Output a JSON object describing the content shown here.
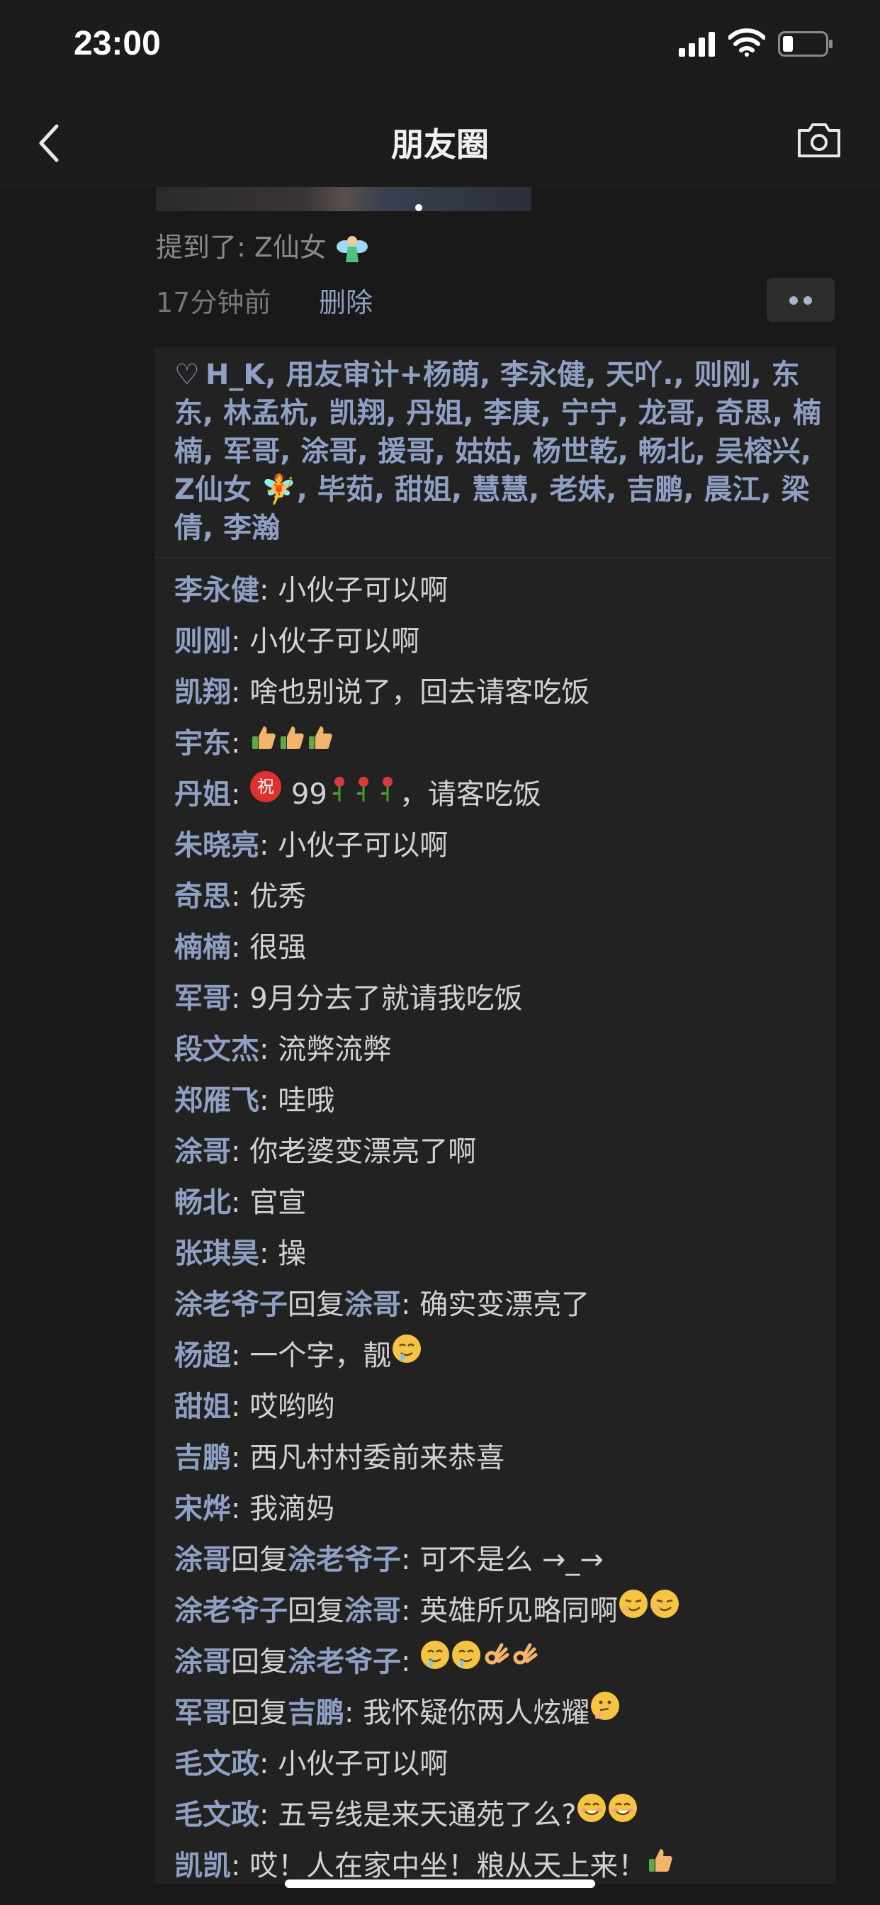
{
  "status_bar": {
    "time": "23:00"
  },
  "nav": {
    "title": "朋友圈"
  },
  "post": {
    "mention_text": "提到了: Z仙女",
    "time_ago": "17分钟前",
    "delete_label": "删除"
  },
  "likes": {
    "names": "H_K, 用友审计+杨萌, 李永健, 天吖., 则刚, 东东, 林孟杭, 凯翔, 丹姐, 李庚, 宁宁, 龙哥, 奇思, 楠楠, 军哥, 涂哥, 援哥, 姑姑, 杨世乾, 畅北, 吴榕兴, Z仙女 🧚, 毕茹, 甜姐, 慧慧, 老妹, 吉鹏, 晨江, 梁倩, 李瀚"
  },
  "comments": [
    {
      "name": "李永健",
      "text": "小伙子可以啊"
    },
    {
      "name": "则刚",
      "text": "小伙子可以啊"
    },
    {
      "name": "凯翔",
      "text": "啥也别说了，回去请客吃饭"
    },
    {
      "name": "宇东",
      "text": "",
      "emojis": [
        "thumb",
        "thumb",
        "thumb"
      ]
    },
    {
      "name": "丹姐",
      "text": "99",
      "pre": [
        "zhu"
      ],
      "emojis": [
        "rose",
        "rose",
        "rose"
      ],
      "text_after": "，请客吃饭"
    },
    {
      "name": "朱晓亮",
      "text": "小伙子可以啊"
    },
    {
      "name": "奇思",
      "text": "优秀"
    },
    {
      "name": "楠楠",
      "text": "很强"
    },
    {
      "name": "军哥",
      "text": "9月分去了就请我吃饭"
    },
    {
      "name": "段文杰",
      "text": "流弊流弊"
    },
    {
      "name": "郑雁飞",
      "text": "哇哦"
    },
    {
      "name": "涂哥",
      "text": "你老婆变漂亮了啊"
    },
    {
      "name": "畅北",
      "text": "官宣"
    },
    {
      "name": "张琪昊",
      "text": "操"
    },
    {
      "name": "涂老爷子",
      "reply_word": "回复",
      "reply_to": "涂哥",
      "text": "确实变漂亮了"
    },
    {
      "name": "杨超",
      "text": "一个字，靓",
      "emojis": [
        "drool"
      ]
    },
    {
      "name": "甜姐",
      "text": "哎哟哟"
    },
    {
      "name": "吉鹏",
      "text": "西凡村村委前来恭喜"
    },
    {
      "name": "宋烨",
      "text": "我滴妈"
    },
    {
      "name": "涂哥",
      "reply_word": "回复",
      "reply_to": "涂老爷子",
      "text": "可不是么 →_→"
    },
    {
      "name": "涂老爷子",
      "reply_word": "回复",
      "reply_to": "涂哥",
      "text": "英雄所见略同啊",
      "emojis": [
        "wink",
        "wink"
      ]
    },
    {
      "name": "涂哥",
      "reply_word": "回复",
      "reply_to": "涂老爷子",
      "text": "",
      "emojis": [
        "drool",
        "drool",
        "ok",
        "ok"
      ]
    },
    {
      "name": "军哥",
      "reply_word": "回复",
      "reply_to": "吉鹏",
      "text": "我怀疑你两人炫耀",
      "emojis": [
        "think"
      ]
    },
    {
      "name": "毛文政",
      "text": "小伙子可以啊"
    },
    {
      "name": "毛文政",
      "text": "五号线是来天通苑了么?",
      "emojis": [
        "smile",
        "smile"
      ]
    },
    {
      "name": "凯凯",
      "text": "哎！人在家中坐！粮从天上来！",
      "emojis": [
        "thumb"
      ]
    }
  ]
}
